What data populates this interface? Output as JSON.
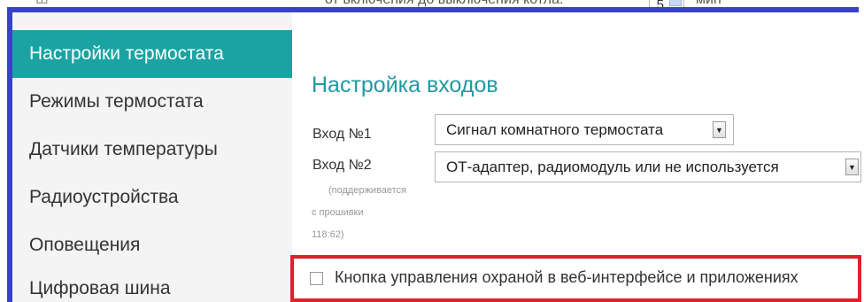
{
  "top": {
    "left_clipped": "Ш",
    "clipped_text": "от включения до выключения котла:",
    "value": "5",
    "unit": "мин"
  },
  "sidebar": {
    "items": [
      {
        "label": "Настройки термостата",
        "active": true
      },
      {
        "label": "Режимы термостата",
        "active": false
      },
      {
        "label": "Датчики температуры",
        "active": false
      },
      {
        "label": "Радиоустройства",
        "active": false
      },
      {
        "label": "Оповещения",
        "active": false
      },
      {
        "label": "Цифровая шина",
        "active": false
      }
    ]
  },
  "main": {
    "section_title": "Настройка входов",
    "input1": {
      "label": "Вход №1",
      "value": "Сигнал комнатного термостата"
    },
    "input2": {
      "label": "Вход №2",
      "value": "ОТ-адаптер, радиомодуль или не используется",
      "note_line1": "(поддерживается",
      "note_line2": "с прошивки",
      "note_line3": "118:62)"
    },
    "security_checkbox": {
      "label": "Кнопка управления охраной в веб-интерфейсе и приложениях",
      "checked": false
    }
  },
  "colors": {
    "accent": "#1ba3a3",
    "title": "#1f9aa3",
    "annotation_blue": "#3a41c9",
    "annotation_red": "#e0202a"
  },
  "icons": {
    "dropdown_arrow": "chevron-down-icon",
    "spin": "spinner-arrows-icon"
  }
}
